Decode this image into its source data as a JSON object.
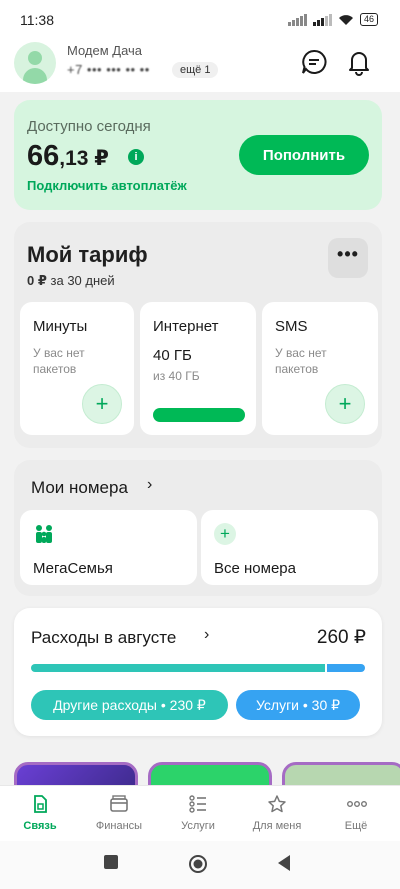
{
  "status": {
    "time": "11:38",
    "battery": "46"
  },
  "header": {
    "account_name": "Модем Дача",
    "account_number": "+7 ••• ••• •• ••",
    "more_chip": "ещё 1"
  },
  "balance": {
    "label": "Доступно сегодня",
    "amount_int": "66",
    "amount_dec": ",13 ₽",
    "autopay_link": "Подключить автоплатёж",
    "topup_button": "Пополнить"
  },
  "tariff": {
    "title": "Мой тариф",
    "price": "0 ₽",
    "period": "за 30 дней",
    "more_button": "•••",
    "packages": [
      {
        "name": "Минуты",
        "muted": "У вас нет пакетов"
      },
      {
        "name": "Интернет",
        "value": "40 ГБ",
        "of": "из 40 ГБ",
        "remaining_fraction": 1.0
      },
      {
        "name": "SMS",
        "muted": "У вас нет пакетов"
      }
    ],
    "add_symbol": "+"
  },
  "numbers": {
    "title": "Мои номера",
    "chevron": "›",
    "cards": [
      {
        "label": "МегаСемья",
        "icon": "family-icon"
      },
      {
        "label": "Все номера",
        "icon": "plus-icon"
      }
    ]
  },
  "expenses": {
    "title": "Расходы в августе",
    "chevron": "›",
    "total": "260 ₽",
    "other_chip": "Другие расходы • 230 ₽",
    "services_chip": "Услуги • 30 ₽",
    "other_value": 230,
    "services_value": 30,
    "colors": {
      "other": "#2ec5b7",
      "services": "#36a3f2"
    }
  },
  "tabs": [
    {
      "label": "Связь",
      "icon": "sim-card-icon",
      "active": true
    },
    {
      "label": "Финансы",
      "icon": "wallet-icon",
      "active": false
    },
    {
      "label": "Услуги",
      "icon": "services-list-icon",
      "active": false
    },
    {
      "label": "Для меня",
      "icon": "star-icon",
      "active": false
    },
    {
      "label": "Ещё",
      "icon": "more-dots-icon",
      "active": false
    }
  ],
  "colors": {
    "accent": "#00b956",
    "balance_bg": "#d6f5df"
  }
}
